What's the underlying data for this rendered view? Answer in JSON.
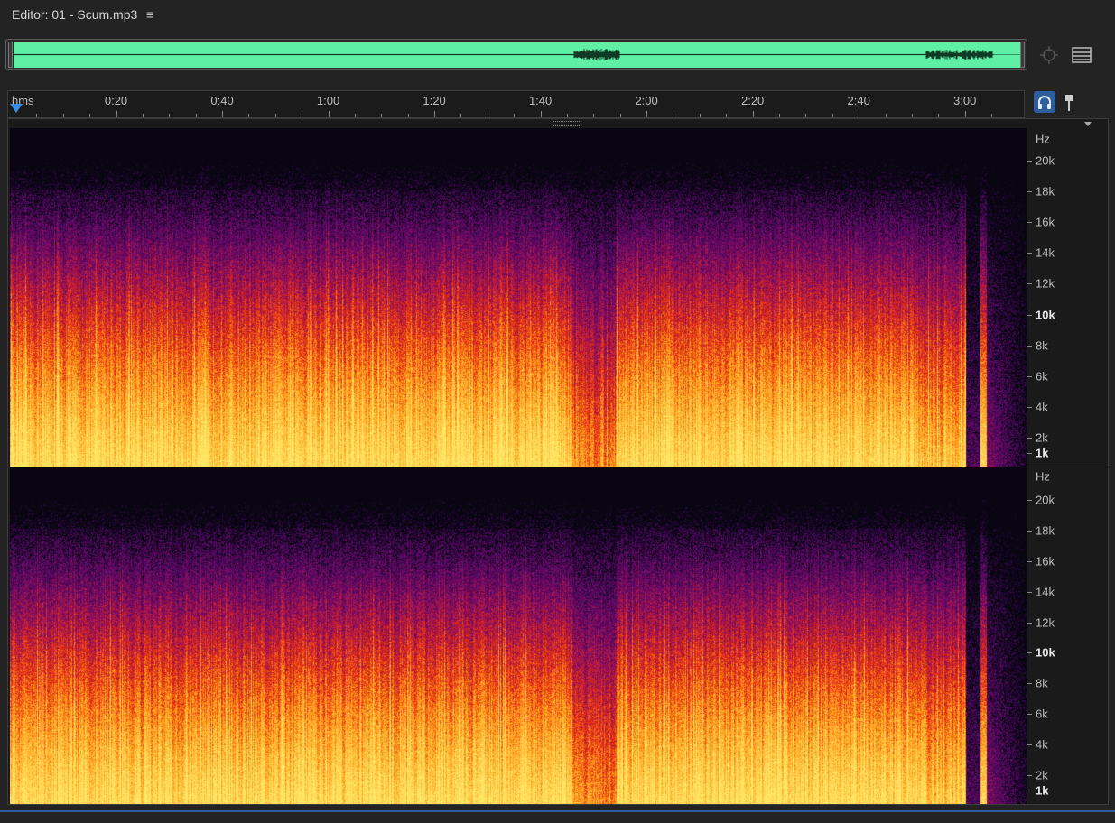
{
  "editor": {
    "title": "Editor: 01 - Scum.mp3",
    "menu_glyph": "≡"
  },
  "toolbar": {
    "zoom_icon": "zoom-navigator-icon",
    "panel_icon": "panel-layout-icon",
    "monitor_icon": "headphones-icon",
    "marker_icon": "marker-pin-icon"
  },
  "timeline": {
    "unit_label": "hms",
    "labels": [
      "0:20",
      "0:40",
      "1:00",
      "1:20",
      "1:40",
      "2:00",
      "2:20",
      "2:40",
      "3:00"
    ],
    "label_seconds": [
      20,
      40,
      60,
      80,
      100,
      120,
      140,
      160,
      180
    ],
    "duration_seconds": 185.5,
    "playhead_seconds": 0
  },
  "frequency_axis": {
    "unit": "Hz",
    "labels": [
      "20k",
      "18k",
      "16k",
      "14k",
      "12k",
      "10k",
      "8k",
      "6k",
      "4k",
      "2k",
      "1k"
    ],
    "values_hz": [
      20000,
      18000,
      16000,
      14000,
      12000,
      10000,
      8000,
      6000,
      4000,
      2000,
      1000
    ],
    "emphasized": [
      "10k",
      "1k"
    ]
  },
  "channels": [
    {
      "id": "left"
    },
    {
      "id": "right"
    }
  ],
  "colors": {
    "waveform": "#5ff0a6",
    "accent": "#2d5d9c",
    "spectrum_low": "#ffd25a",
    "spectrum_mid": "#e0321e",
    "spectrum_high": "#6a1a6e",
    "background": "#232323"
  }
}
